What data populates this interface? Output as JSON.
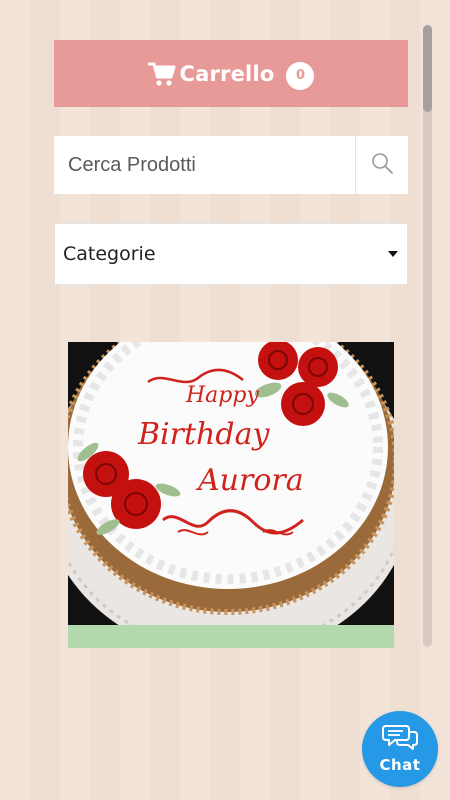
{
  "cart": {
    "label": "Carrello",
    "count": "0",
    "icon": "cart-icon"
  },
  "search": {
    "placeholder": "Cerca Prodotti",
    "value": "",
    "icon": "search-icon"
  },
  "categories": {
    "selected": "Categorie",
    "icon": "caret-down-icon"
  },
  "product": {
    "image_text": [
      "Happy",
      "Birthday",
      "Aurora"
    ]
  },
  "chat": {
    "label": "Chat",
    "icon": "chat-bubbles-icon"
  },
  "colors": {
    "cart_bg": "#e89a99",
    "product_footer": "#b2d8ae",
    "chat_bg": "#2699e6",
    "page_bg": "#f1e1d6"
  }
}
